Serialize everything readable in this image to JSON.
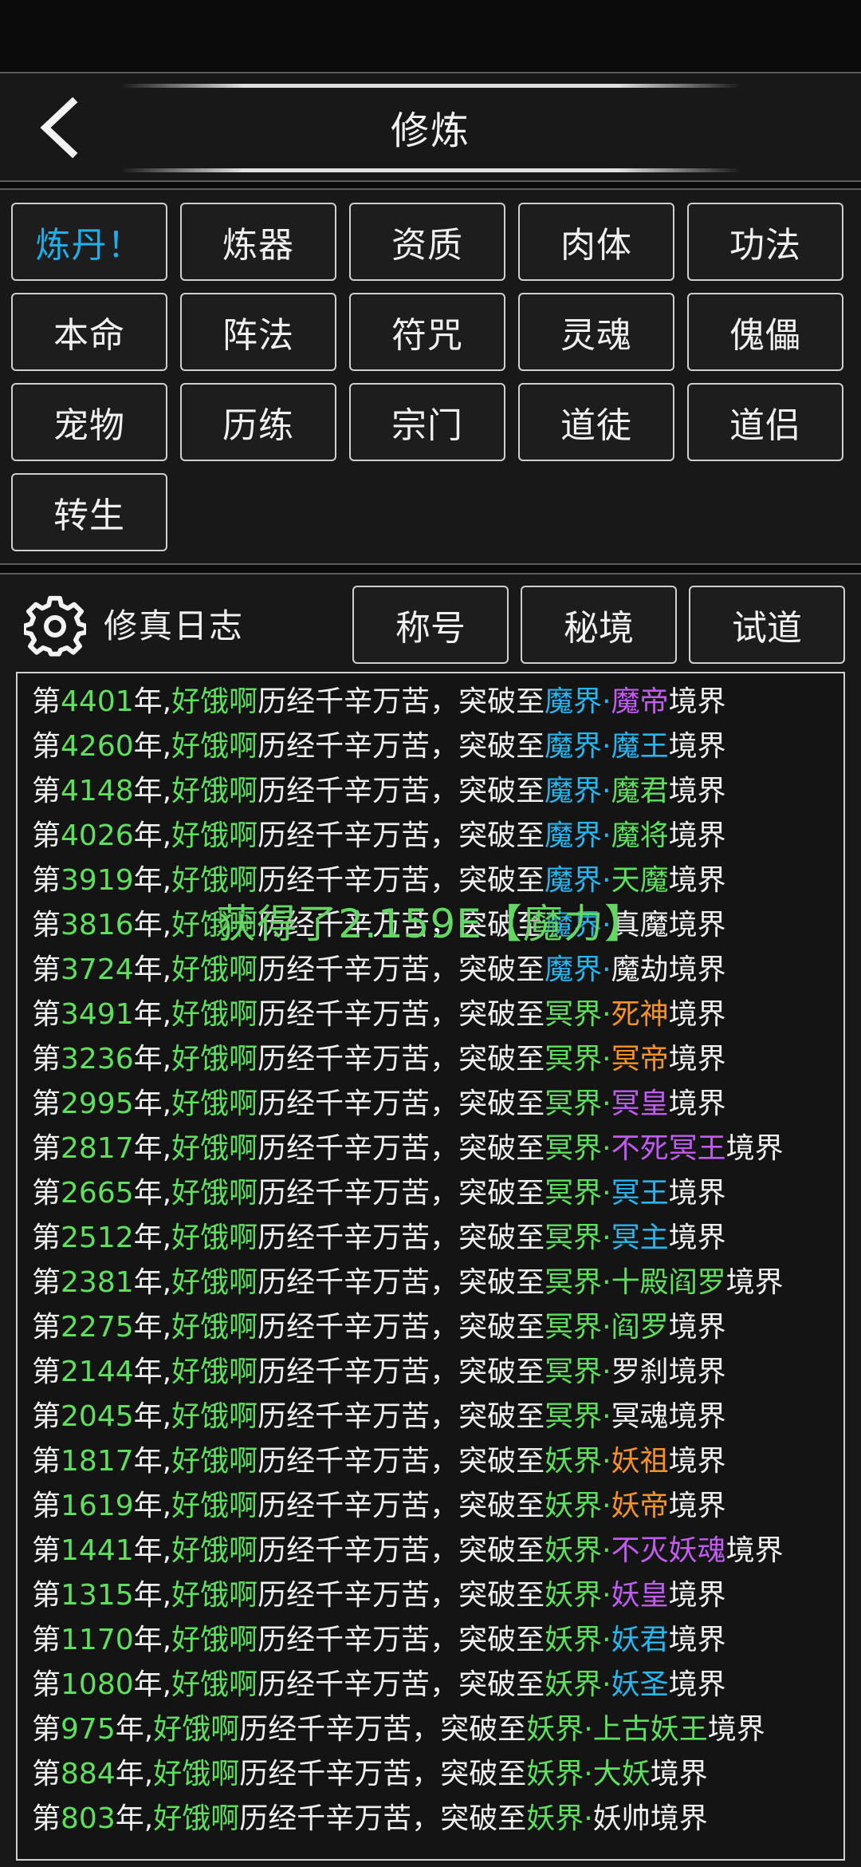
{
  "header": {
    "title": "修炼"
  },
  "menu": [
    {
      "label": "炼丹！",
      "active": true
    },
    {
      "label": "炼器"
    },
    {
      "label": "资质"
    },
    {
      "label": "肉体"
    },
    {
      "label": "功法"
    },
    {
      "label": "本命"
    },
    {
      "label": "阵法"
    },
    {
      "label": "符咒"
    },
    {
      "label": "灵魂"
    },
    {
      "label": "傀儡"
    },
    {
      "label": "宠物"
    },
    {
      "label": "历练"
    },
    {
      "label": "宗门"
    },
    {
      "label": "道徒"
    },
    {
      "label": "道侣"
    },
    {
      "label": "转生"
    }
  ],
  "log": {
    "title": "修真日志",
    "tabs": [
      "称号",
      "秘境",
      "试道"
    ],
    "character": "好饿啊",
    "text": {
      "prefix": "第",
      "year_suffix": "年,",
      "middle": "历经千辛万苦，突破至",
      "dot": "·",
      "suffix": "境界"
    },
    "entries": [
      {
        "year": "4401",
        "world": "魔界",
        "world_color": "blue",
        "rank": "魔帝",
        "rank_color": "purple"
      },
      {
        "year": "4260",
        "world": "魔界",
        "world_color": "blue",
        "rank": "魔王",
        "rank_color": "blue"
      },
      {
        "year": "4148",
        "world": "魔界",
        "world_color": "blue",
        "rank": "魔君",
        "rank_color": "green"
      },
      {
        "year": "4026",
        "world": "魔界",
        "world_color": "blue",
        "rank": "魔将",
        "rank_color": "green"
      },
      {
        "year": "3919",
        "world": "魔界",
        "world_color": "blue",
        "rank": "天魔",
        "rank_color": "green"
      },
      {
        "year": "3816",
        "world": "魔界",
        "world_color": "blue",
        "rank": "真魔",
        "rank_color": "white"
      },
      {
        "year": "3724",
        "world": "魔界",
        "world_color": "blue",
        "rank": "魔劫",
        "rank_color": "white"
      },
      {
        "year": "3491",
        "world": "冥界",
        "world_color": "green",
        "rank": "死神",
        "rank_color": "orange"
      },
      {
        "year": "3236",
        "world": "冥界",
        "world_color": "green",
        "rank": "冥帝",
        "rank_color": "orange"
      },
      {
        "year": "2995",
        "world": "冥界",
        "world_color": "green",
        "rank": "冥皇",
        "rank_color": "purple"
      },
      {
        "year": "2817",
        "world": "冥界",
        "world_color": "green",
        "rank": "不死冥王",
        "rank_color": "purple"
      },
      {
        "year": "2665",
        "world": "冥界",
        "world_color": "green",
        "rank": "冥王",
        "rank_color": "blue"
      },
      {
        "year": "2512",
        "world": "冥界",
        "world_color": "green",
        "rank": "冥主",
        "rank_color": "blue"
      },
      {
        "year": "2381",
        "world": "冥界",
        "world_color": "green",
        "rank": "十殿阎罗",
        "rank_color": "green"
      },
      {
        "year": "2275",
        "world": "冥界",
        "world_color": "green",
        "rank": "阎罗",
        "rank_color": "green"
      },
      {
        "year": "2144",
        "world": "冥界",
        "world_color": "green",
        "rank": "罗刹",
        "rank_color": "white"
      },
      {
        "year": "2045",
        "world": "冥界",
        "world_color": "green",
        "rank": "冥魂",
        "rank_color": "white"
      },
      {
        "year": "1817",
        "world": "妖界",
        "world_color": "green",
        "rank": "妖祖",
        "rank_color": "orange"
      },
      {
        "year": "1619",
        "world": "妖界",
        "world_color": "green",
        "rank": "妖帝",
        "rank_color": "orange"
      },
      {
        "year": "1441",
        "world": "妖界",
        "world_color": "green",
        "rank": "不灭妖魂",
        "rank_color": "purple"
      },
      {
        "year": "1315",
        "world": "妖界",
        "world_color": "green",
        "rank": "妖皇",
        "rank_color": "purple"
      },
      {
        "year": "1170",
        "world": "妖界",
        "world_color": "green",
        "rank": "妖君",
        "rank_color": "blue"
      },
      {
        "year": "1080",
        "world": "妖界",
        "world_color": "green",
        "rank": "妖圣",
        "rank_color": "blue"
      },
      {
        "year": "975",
        "world": "妖界",
        "world_color": "green",
        "rank": "上古妖王",
        "rank_color": "green"
      },
      {
        "year": "884",
        "world": "妖界",
        "world_color": "green",
        "rank": "大妖",
        "rank_color": "green"
      },
      {
        "year": "803",
        "world": "妖界",
        "world_color": "green",
        "rank": "妖帅",
        "rank_color": "white"
      }
    ]
  },
  "toast": {
    "text": "获得了2.159E【魔力】"
  },
  "colors": {
    "green": "#5ee05e",
    "blue": "#27b6ee",
    "purple": "#c15cf0",
    "orange": "#f39227",
    "white": "#f0f0f0",
    "active_tab": "#1faee8"
  },
  "icons": {
    "back": "chevron-left-icon",
    "settings": "gear-icon"
  }
}
